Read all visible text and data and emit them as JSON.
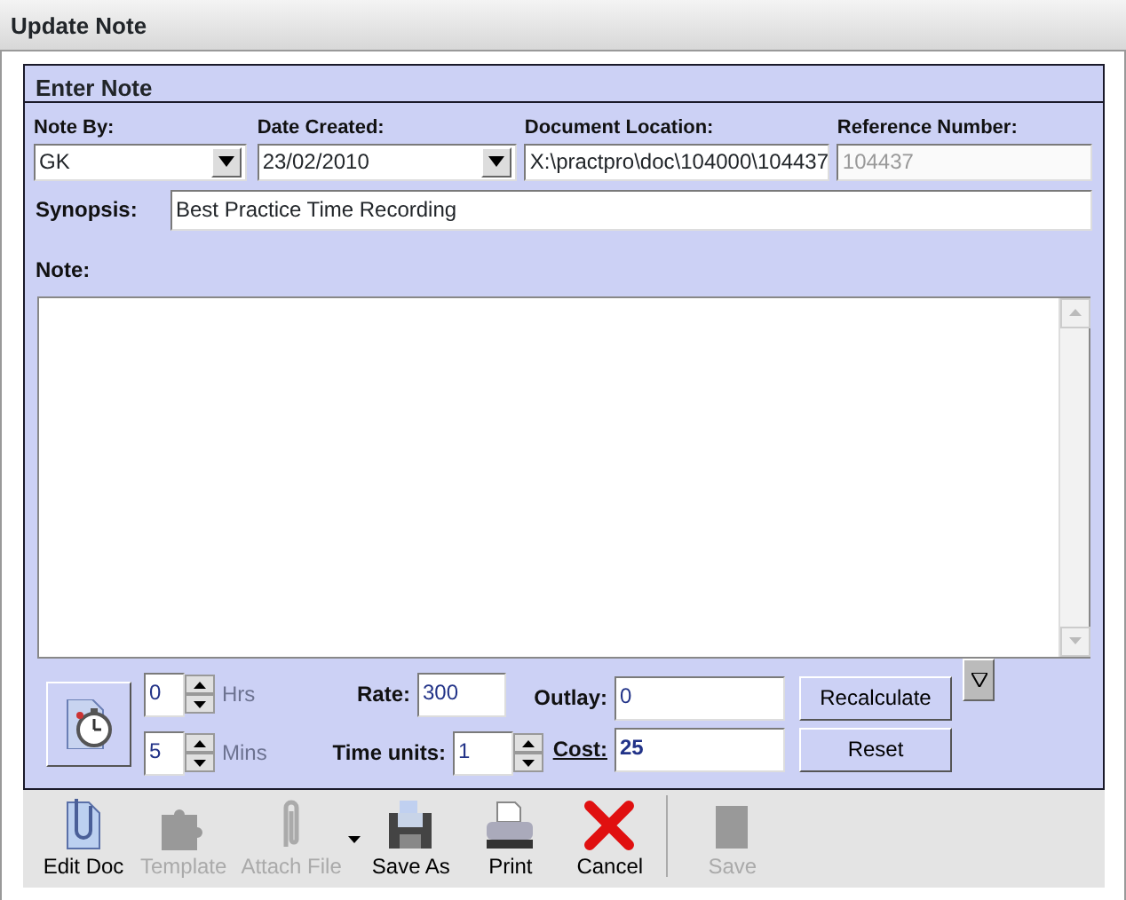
{
  "window": {
    "title": "Update Note"
  },
  "panel": {
    "title": "Enter Note"
  },
  "top_fields": [
    {
      "label": "Note By:",
      "value": "GK",
      "kind": "dropdown",
      "disabled": false
    },
    {
      "label": "Date Created:",
      "value": "23/02/2010",
      "kind": "dropdown",
      "disabled": false
    },
    {
      "label": "Document Location:",
      "value": "X:\\practpro\\doc\\104000\\104437",
      "kind": "text",
      "disabled": false
    },
    {
      "label": "Reference Number:",
      "value": "104437",
      "kind": "text",
      "disabled": true
    }
  ],
  "synopsis": {
    "label": "Synopsis:",
    "value": "Best Practice Time Recording"
  },
  "note": {
    "label": "Note:"
  },
  "duration": [
    {
      "value": "0",
      "unit": "Hrs",
      "disabled": true
    },
    {
      "value": "5",
      "unit": "Mins",
      "disabled": true
    }
  ],
  "rate": {
    "label": "Rate:",
    "value": "300"
  },
  "time_units": {
    "label": "Time units:",
    "value": "1"
  },
  "outlay": {
    "label": "Outlay:",
    "value": "0"
  },
  "cost": {
    "label": "Cost:",
    "value": "25"
  },
  "buttons": [
    "Recalculate",
    "Reset"
  ],
  "toolbar": [
    {
      "label": "Edit Doc",
      "disabled": false
    },
    {
      "label": "Template",
      "disabled": true
    },
    {
      "label": "Attach File",
      "disabled": true,
      "dropdown": true
    },
    {
      "label": "Save As",
      "disabled": false
    },
    {
      "label": "Print",
      "disabled": false
    },
    {
      "label": "Cancel",
      "disabled": false,
      "separator_after": true
    },
    {
      "label": "Save",
      "disabled": true
    }
  ]
}
